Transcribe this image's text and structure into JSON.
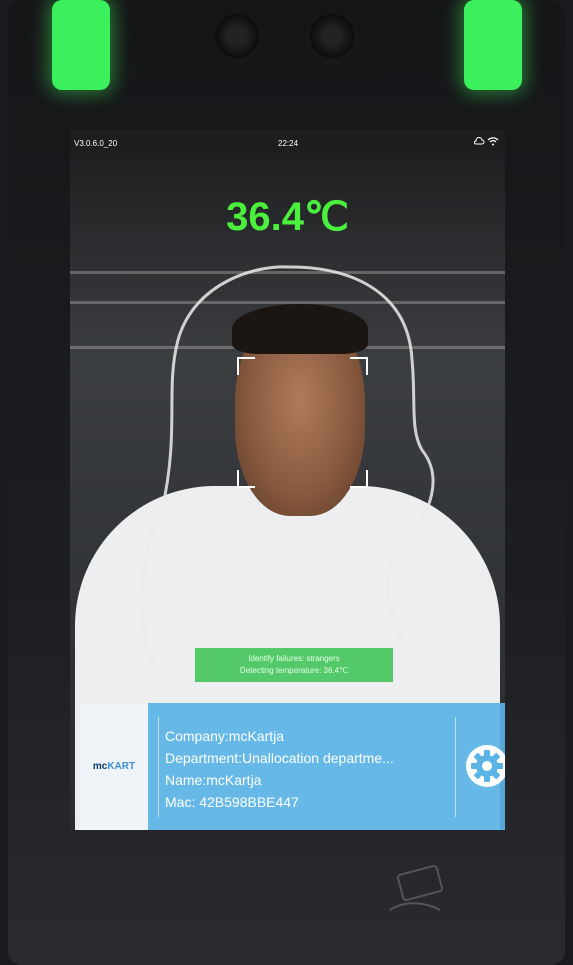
{
  "status_bar": {
    "version": "V3.0.6.0_20",
    "time": "22:24",
    "icons": [
      "cloud-icon",
      "wifi-icon"
    ]
  },
  "temperature": "36.4℃",
  "recognition_message": {
    "line1": "Identify failures: strangers",
    "line2": "Detecting temperature: 36.4℃"
  },
  "info_panel": {
    "logo": {
      "part1": "mc",
      "part2": "KART"
    },
    "company": "Company:mcKartja",
    "department": "Department:Unallocation departme...",
    "name": "Name:mcKartja",
    "mac": "Mac: 42B598BBE447"
  },
  "colors": {
    "indicator_light": "#3bf05c",
    "temperature_text": "#4af03c",
    "message_box": "#43c45a",
    "info_panel": "#5ab4e6"
  }
}
